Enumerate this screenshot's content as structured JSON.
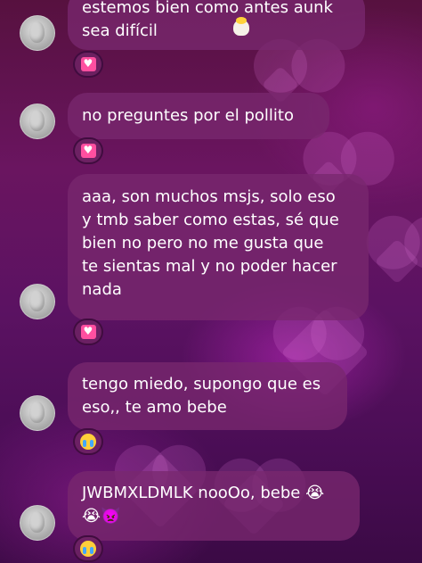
{
  "messages": [
    {
      "id": 1,
      "lines": "estemos bien como antes aunk\nsea difícil",
      "emoji_icon": "hatching-chick-icon",
      "reaction_icon": "heart-box-icon"
    },
    {
      "id": 2,
      "lines": "no preguntes por el pollito",
      "reaction_icon": "heart-box-icon"
    },
    {
      "id": 3,
      "lines": "aaa, son muchos msjs, solo eso\ny tmb saber como estas, sé que\nbien no pero no me gusta que\nte sientas mal y no poder hacer\nnada",
      "reaction_icon": "heart-box-icon"
    },
    {
      "id": 4,
      "lines": "tengo miedo, supongo que es\neso,, te amo bebe",
      "reaction_icon": "crying-face-icon"
    },
    {
      "id": 5,
      "lines": "JWBMXLDMLK nooOo, bebe 😭\n😭👿",
      "reaction_icon": "crying-face-icon"
    }
  ],
  "colors": {
    "bubble": "#782a6e",
    "reaction_heart": "#ff4fa0",
    "text": "#ffffff"
  }
}
